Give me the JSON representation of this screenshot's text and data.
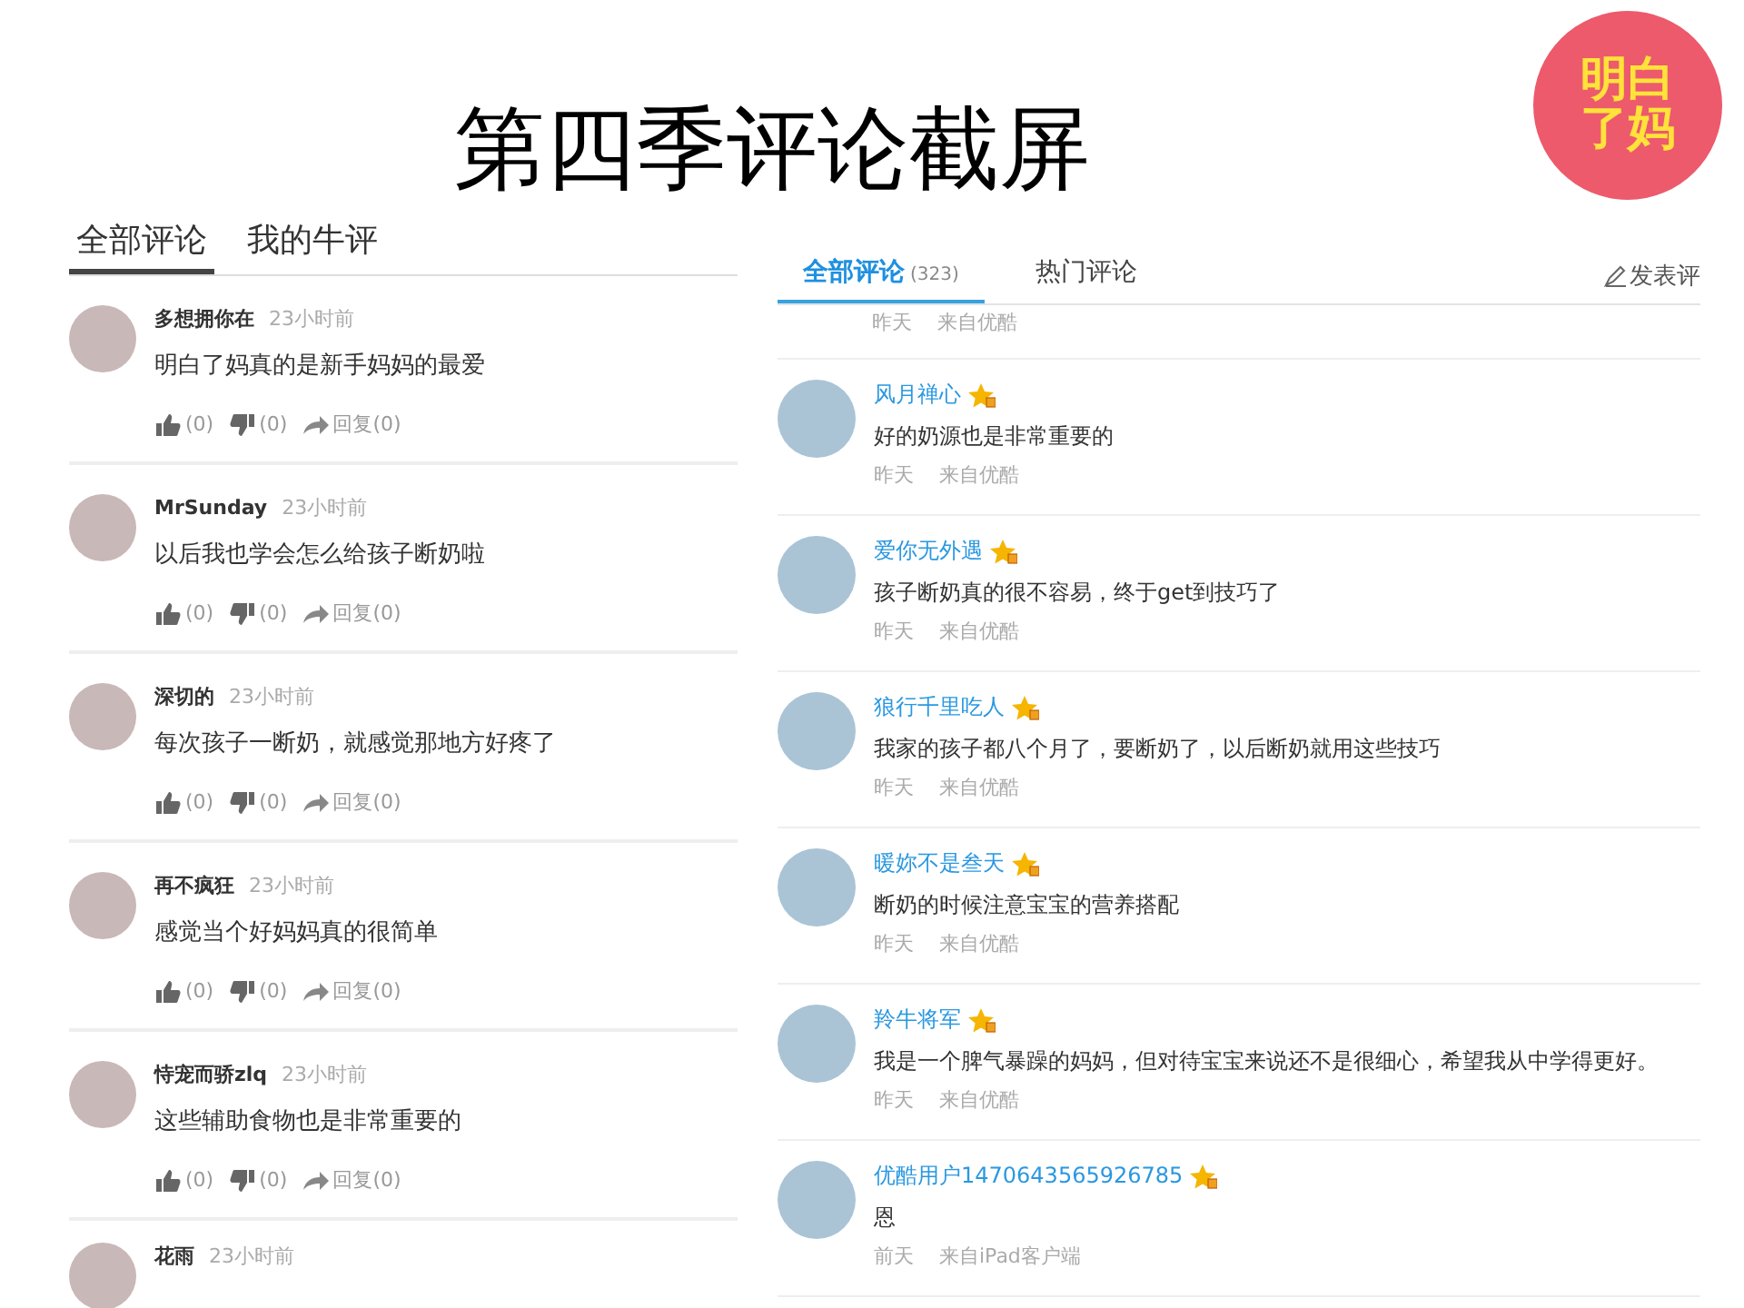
{
  "slide_title": "第四季评论截屏",
  "logo": {
    "text": "明白了妈"
  },
  "left_panel": {
    "tabs": [
      {
        "label": "全部评论",
        "selected": true
      },
      {
        "label": "我的牛评",
        "selected": false
      }
    ],
    "comments": [
      {
        "user": "多想拥你在",
        "time": "23小时前",
        "text": "明白了妈真的是新手妈妈的最爱",
        "likes": "(0)",
        "dislikes": "(0)",
        "reply": "回复(0)"
      },
      {
        "user": "MrSunday",
        "time": "23小时前",
        "text": "以后我也学会怎么给孩子断奶啦",
        "likes": "(0)",
        "dislikes": "(0)",
        "reply": "回复(0)"
      },
      {
        "user": "深切的",
        "time": "23小时前",
        "text": "每次孩子一断奶，就感觉那地方好疼了",
        "likes": "(0)",
        "dislikes": "(0)",
        "reply": "回复(0)"
      },
      {
        "user": "再不疯狂",
        "time": "23小时前",
        "text": "感觉当个好妈妈真的很简单",
        "likes": "(0)",
        "dislikes": "(0)",
        "reply": "回复(0)"
      },
      {
        "user": "恃宠而骄zlq",
        "time": "23小时前",
        "text": "这些辅助食物也是非常重要的",
        "likes": "(0)",
        "dislikes": "(0)",
        "reply": "回复(0)"
      },
      {
        "user": "花雨",
        "time": "23小时前"
      }
    ]
  },
  "right_panel": {
    "tabs": [
      {
        "label": "全部评论",
        "count": "(323)",
        "selected": true
      },
      {
        "label": "热门评论",
        "selected": false
      }
    ],
    "post_link": "发表评",
    "top_meta": {
      "date": "昨天",
      "source": "来自优酷"
    },
    "comments": [
      {
        "user": "风月禅心",
        "text": "好的奶源也是非常重要的",
        "date": "昨天",
        "source": "来自优酷"
      },
      {
        "user": "爱你无外遇",
        "text": "孩子断奶真的很不容易，终于get到技巧了",
        "date": "昨天",
        "source": "来自优酷"
      },
      {
        "user": "狼行千里吃人",
        "text": "我家的孩子都八个月了，要断奶了，以后断奶就用这些技巧",
        "date": "昨天",
        "source": "来自优酷"
      },
      {
        "user": "暖妳不是叁天",
        "text": "断奶的时候注意宝宝的营养搭配",
        "date": "昨天",
        "source": "来自优酷"
      },
      {
        "user": "羚牛将军",
        "text": "我是一个脾气暴躁的妈妈，但对待宝宝来说还不是很细心，希望我从中学得更好。",
        "date": "昨天",
        "source": "来自优酷"
      },
      {
        "user": "优酷用户1470643565926785",
        "text": "恩",
        "date": "前天",
        "source": "来自iPad客户端"
      }
    ]
  }
}
